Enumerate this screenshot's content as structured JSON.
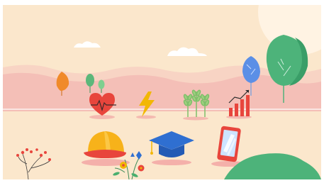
{
  "illustration": {
    "icons": [
      "heart-pulse-icon",
      "lightning-bolt-icon",
      "wheat-plants-icon",
      "growth-chart-icon",
      "hard-hat-icon",
      "graduation-cap-icon",
      "smartphone-icon"
    ],
    "colors": {
      "background": "#fbe7cc",
      "hills": "#f6c9bf",
      "accent_red": "#e8453c",
      "accent_yellow": "#f2b705",
      "accent_blue": "#2f6fd1",
      "accent_green": "#4aaf6e"
    }
  }
}
